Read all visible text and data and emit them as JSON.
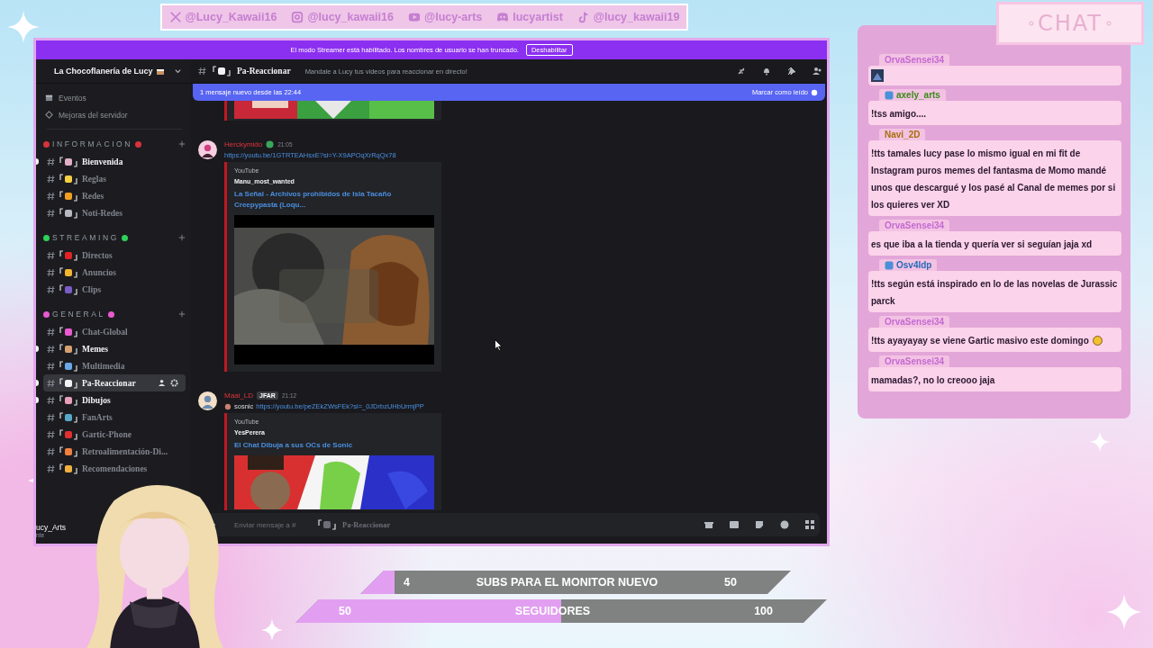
{
  "socials": [
    {
      "kind": "x",
      "handle": "@Lucy_Kawaii16"
    },
    {
      "kind": "instagram",
      "handle": "@lucy_kawaii16"
    },
    {
      "kind": "youtube",
      "handle": "@lucy-arts"
    },
    {
      "kind": "discord",
      "handle": "lucyartist"
    },
    {
      "kind": "tiktok",
      "handle": "@lucy_kawaii19"
    }
  ],
  "discord": {
    "streamer_banner": {
      "text": "El modo Streamer está habilitado. Los nombres de usuario se han truncado.",
      "button": "Deshabilitar"
    },
    "server_name": "La Chocoflanería de Lucy",
    "sidebar_top": [
      {
        "kind": "calendar",
        "label": "Eventos"
      },
      {
        "kind": "boost",
        "label": "Mejoras del servidor"
      }
    ],
    "categories": [
      {
        "name": "INFORMACION",
        "color": "#d8323c",
        "channels": [
          {
            "name": "Bienvenida",
            "color": "#e0b0c8",
            "unread": true,
            "selected": false
          },
          {
            "name": "Reglas",
            "color": "#f5d142",
            "unread": false,
            "selected": false
          },
          {
            "name": "Redes",
            "color": "#f0a020",
            "unread": false,
            "selected": false
          },
          {
            "name": "Noti-Redes",
            "color": "#b8b8c0",
            "unread": false,
            "selected": false
          }
        ]
      },
      {
        "name": "STREAMING",
        "color": "#2fd158",
        "channels": [
          {
            "name": "Directos",
            "color": "#e02424",
            "unread": false,
            "selected": false
          },
          {
            "name": "Anuncios",
            "color": "#f2b530",
            "unread": false,
            "selected": false
          },
          {
            "name": "Clips",
            "color": "#7a5cc8",
            "unread": false,
            "selected": false
          }
        ]
      },
      {
        "name": "GENERAL",
        "color": "#e85ad0",
        "channels": [
          {
            "name": "Chat-Global",
            "color": "#e85ad0",
            "unread": false,
            "selected": false
          },
          {
            "name": "Memes",
            "color": "#d8a070",
            "unread": true,
            "selected": false
          },
          {
            "name": "Multimedia",
            "color": "#6aa8e8",
            "unread": false,
            "selected": false
          },
          {
            "name": "Pa-Reaccionar",
            "color": "#f2f3f5",
            "unread": true,
            "selected": true
          },
          {
            "name": "Dibujos",
            "color": "#e8a0b8",
            "unread": true,
            "selected": false
          },
          {
            "name": "FanArts",
            "color": "#58a8c8",
            "unread": false,
            "selected": false
          },
          {
            "name": "Gartic-Phone",
            "color": "#e03030",
            "unread": false,
            "selected": false
          },
          {
            "name": "Retroalimentación-Di...",
            "color": "#f08040",
            "unread": false,
            "selected": false
          },
          {
            "name": "Recomendaciones",
            "color": "#f0b040",
            "unread": false,
            "selected": false
          }
        ]
      }
    ],
    "user_name": "ucy_Arts",
    "user_status": "nte",
    "channel": {
      "name": "Pa-Reaccionar",
      "topic": "Mandale a Lucy tus videos para reaccionar en directo!"
    },
    "new_messages": {
      "text": "1 mensaje nuevo desde las 22:44",
      "action": "Marcar como leído"
    },
    "messages": [
      {
        "author": "Herckymido",
        "author_badge": true,
        "time": "21:05",
        "link": "https://youtu.be/1GTRTEAHsxE?si=Y-X9APOqXrRqQx78",
        "embed": {
          "provider": "YouTube",
          "channel": "Manu_most_wanted",
          "title": "La Señal - Archivos prohibidos de Isla Tacaño Creepypasta (Loqu..."
        }
      },
      {
        "author": "Maai_LD",
        "author_badge": false,
        "tag": "JFAR",
        "time": "21:12",
        "prefix": "sosnic",
        "link": "https://youtu.be/peZEkZWsFEk?si=_0JDrbzUHbUrmjPP",
        "embed": {
          "provider": "YouTube",
          "channel": "YesPerera",
          "title": "El Chat Dibuja a sus OCs de Sonic"
        }
      }
    ],
    "composer": {
      "placeholder": "Enviar mensaje a #",
      "channel": "Pa-Reaccionar"
    }
  },
  "chat": {
    "title": "CHAT",
    "messages": [
      {
        "user": "OrvaSensei34",
        "color": "#c46ad2",
        "badge": false,
        "kind": "emote"
      },
      {
        "user": "axely_arts",
        "color": "#3c8a18",
        "badge": true,
        "kind": "text",
        "text": "!tss amigo....",
        "emoji": false
      },
      {
        "user": "Navi_2D",
        "color": "#a8700a",
        "badge": false,
        "kind": "text",
        "text": "!tts tamales lucy pase lo mismo igual en mi fit de Instagram puros memes del fantasma de Momo mandé unos que descargué y los pasé al Canal de memes por si los quieres ver XD",
        "emoji": false
      },
      {
        "user": "OrvaSensei34",
        "color": "#c46ad2",
        "badge": false,
        "kind": "text",
        "text": "es que iba a la tienda y quería ver si seguían jaja xd",
        "emoji": false
      },
      {
        "user": "Osv4ldp",
        "color": "#2a6ab8",
        "badge": true,
        "kind": "text",
        "text": "!tts según está inspirado en lo de las novelas de Jurassic parck",
        "emoji": false
      },
      {
        "user": "OrvaSensei34",
        "color": "#c46ad2",
        "badge": false,
        "kind": "text",
        "text": "!tts ayayayay se viene Gartic masivo este domingo",
        "emoji": true
      },
      {
        "user": "OrvaSensei34",
        "color": "#c46ad2",
        "badge": false,
        "kind": "text",
        "text": "mamadas?, no lo creooo jaja",
        "emoji": false
      }
    ]
  },
  "goals": [
    {
      "current": "4",
      "label": "SUBS PARA EL MONITOR NUEVO",
      "target": "50",
      "level": 0.08
    },
    {
      "current": "50",
      "label": "SEGUIDORES",
      "target": "100",
      "level": 0.5
    }
  ]
}
